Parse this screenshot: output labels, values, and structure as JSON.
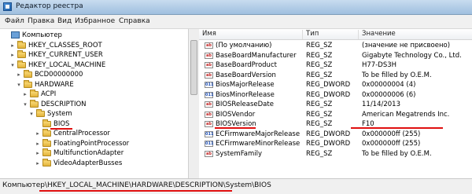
{
  "window": {
    "title": "Редактор реестра",
    "icon": "registry-editor-icon"
  },
  "menu": [
    "Файл",
    "Правка",
    "Вид",
    "Избранное",
    "Справка"
  ],
  "tree": [
    {
      "label": "Компьютер",
      "level": 0,
      "expander": "",
      "icon": "computer-icon",
      "selected": false
    },
    {
      "label": "HKEY_CLASSES_ROOT",
      "level": 1,
      "expander": "▸",
      "icon": "folder-icon",
      "selected": false
    },
    {
      "label": "HKEY_CURRENT_USER",
      "level": 1,
      "expander": "▸",
      "icon": "folder-icon",
      "selected": false
    },
    {
      "label": "HKEY_LOCAL_MACHINE",
      "level": 1,
      "expander": "▾",
      "icon": "folder-icon",
      "selected": false
    },
    {
      "label": "BCD00000000",
      "level": 2,
      "expander": "▸",
      "icon": "folder-icon",
      "selected": false
    },
    {
      "label": "HARDWARE",
      "level": 2,
      "expander": "▾",
      "icon": "folder-icon",
      "selected": false
    },
    {
      "label": "ACPI",
      "level": 3,
      "expander": "▸",
      "icon": "folder-icon",
      "selected": false
    },
    {
      "label": "DESCRIPTION",
      "level": 3,
      "expander": "▾",
      "icon": "folder-icon",
      "selected": false
    },
    {
      "label": "System",
      "level": 4,
      "expander": "▾",
      "icon": "folder-icon",
      "selected": false
    },
    {
      "label": "BIOS",
      "level": 5,
      "expander": "",
      "icon": "folder-icon",
      "selected": true
    },
    {
      "label": "CentralProcessor",
      "level": 5,
      "expander": "▸",
      "icon": "folder-icon",
      "selected": false
    },
    {
      "label": "FloatingPointProcessor",
      "level": 5,
      "expander": "▸",
      "icon": "folder-icon",
      "selected": false
    },
    {
      "label": "MultifunctionAdapter",
      "level": 5,
      "expander": "▸",
      "icon": "folder-icon",
      "selected": false
    },
    {
      "label": "VideoAdapterBusses",
      "level": 5,
      "expander": "▸",
      "icon": "folder-icon",
      "selected": false
    }
  ],
  "columns": {
    "name": "Имя",
    "type": "Тип",
    "value": "Значение"
  },
  "values": [
    {
      "name": "(По умолчанию)",
      "type": "REG_SZ",
      "data": "(значение не присвоено)",
      "kind": "sz"
    },
    {
      "name": "BaseBoardManufacturer",
      "type": "REG_SZ",
      "data": "Gigabyte Technology Co., Ltd.",
      "kind": "sz"
    },
    {
      "name": "BaseBoardProduct",
      "type": "REG_SZ",
      "data": "H77-DS3H",
      "kind": "sz"
    },
    {
      "name": "BaseBoardVersion",
      "type": "REG_SZ",
      "data": "To be filled by O.E.M.",
      "kind": "sz"
    },
    {
      "name": "BiosMajorRelease",
      "type": "REG_DWORD",
      "data": "0x00000004 (4)",
      "kind": "dw"
    },
    {
      "name": "BiosMinorRelease",
      "type": "REG_DWORD",
      "data": "0x00000006 (6)",
      "kind": "dw"
    },
    {
      "name": "BIOSReleaseDate",
      "type": "REG_SZ",
      "data": "11/14/2013",
      "kind": "sz"
    },
    {
      "name": "BIOSVendor",
      "type": "REG_SZ",
      "data": "American Megatrends Inc.",
      "kind": "sz"
    },
    {
      "name": "BIOSVersion",
      "type": "REG_SZ",
      "data": "F10",
      "kind": "sz"
    },
    {
      "name": "ECFirmwareMajorRelease",
      "type": "REG_DWORD",
      "data": "0x000000ff (255)",
      "kind": "dw"
    },
    {
      "name": "ECFirmwareMinorRelease",
      "type": "REG_DWORD",
      "data": "0x000000ff (255)",
      "kind": "dw"
    },
    {
      "name": "SystemFamily",
      "type": "REG_SZ",
      "data": "To be filled by O.E.M.",
      "kind": "sz"
    }
  ],
  "status": {
    "path": "Компьютер\\HKEY_LOCAL_MACHINE\\HARDWARE\\DESCRIPTION\\System\\BIOS"
  },
  "colors": {
    "annotation_red": "#e01010",
    "selection": "#ffffff"
  }
}
